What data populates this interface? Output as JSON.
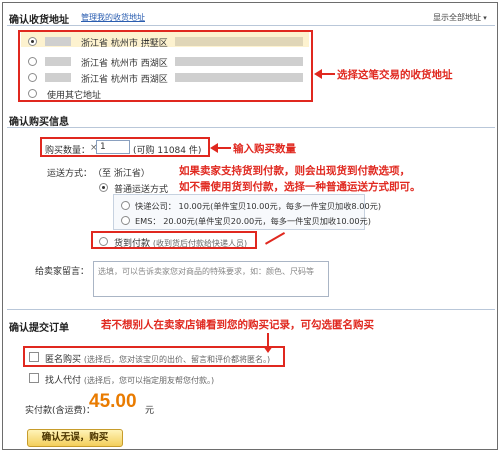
{
  "address_section": {
    "title": "确认收货地址",
    "manage_link": "管理我的收货地址",
    "show_all": "显示全部地址",
    "addresses": [
      {
        "province": "浙江省",
        "city": "杭州市",
        "district": "拱墅区",
        "selected": true
      },
      {
        "province": "浙江省",
        "city": "杭州市",
        "district": "西湖区",
        "selected": false
      },
      {
        "province": "浙江省",
        "city": "杭州市",
        "district": "西湖区",
        "selected": false
      }
    ],
    "other_address": "使用其它地址"
  },
  "purchase_section": {
    "title": "确认购买信息",
    "quantity_label": "购买数量：",
    "quantity_value": "1",
    "quantity_times": "×",
    "available": "(可购 11084 件)",
    "shipping_label": "运送方式：",
    "shipping_to": "（至 浙江省）",
    "standard": "普通运送方式",
    "express": "快递公司： 10.00元(单件宝贝10.00元，每多一件宝贝加收8.00元)",
    "ems": "EMS： 20.00元(单件宝贝20.00元，每多一件宝贝加收10.00元)",
    "cod": "货到付款",
    "cod_note": "(收到货后付款给快递人员)",
    "message_label": "给卖家留言：",
    "message_placeholder": "选填，可以告诉卖家您对商品的特殊要求，如：颜色、尺码等"
  },
  "order_section": {
    "title": "确认提交订单",
    "anonymous": "匿名购买",
    "anonymous_note": "(选择后，您对该宝贝的出价、留言和评价都将匿名。)",
    "proxy": "找人代付",
    "proxy_note": "(选择后，您可以指定朋友帮您付款。)",
    "total_label": "实付款(含运费)：",
    "total_value": "45.00",
    "total_unit": "元",
    "submit": "确认无误，购买"
  },
  "annotations": {
    "address": "选择这笔交易的收货地址",
    "quantity": "输入购买数量",
    "cod_line1": "如果卖家支持货到付款，则会出现货到付款选项，",
    "cod_line2": "如不需使用货到付款，选择一种普通运送方式即可。",
    "anonymous": "若不想别人在卖家店铺看到您的购买记录，可勾选匿名购买"
  },
  "colors": {
    "annotation": "#e0281f",
    "total_price": "#e97b00",
    "link": "#2a5db0"
  }
}
